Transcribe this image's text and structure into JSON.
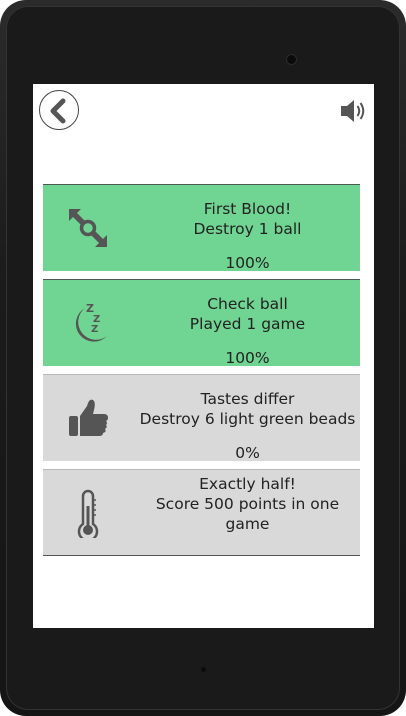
{
  "header": {
    "back_icon": "back-chevron-icon",
    "sound_icon": "speaker-sound-icon"
  },
  "colors": {
    "completed": "#70d592",
    "locked": "#d9d9d9",
    "icon": "#555555",
    "text": "#222222"
  },
  "achievements": [
    {
      "title": "First Blood!",
      "description": "Destroy 1 ball",
      "progress": "100%",
      "completed": true,
      "icon": "arrows-link-icon"
    },
    {
      "title": "Check ball",
      "description": "Played 1 game",
      "progress": "100%",
      "completed": true,
      "icon": "moon-sleep-icon"
    },
    {
      "title": "Tastes differ",
      "description": "Destroy 6 light green beads",
      "progress": "0%",
      "completed": false,
      "icon": "thumbs-up-icon"
    },
    {
      "title": "Exactly half!",
      "description": "Score 500 points in one",
      "description2": "game",
      "progress": "",
      "completed": false,
      "icon": "thermometer-icon"
    }
  ]
}
